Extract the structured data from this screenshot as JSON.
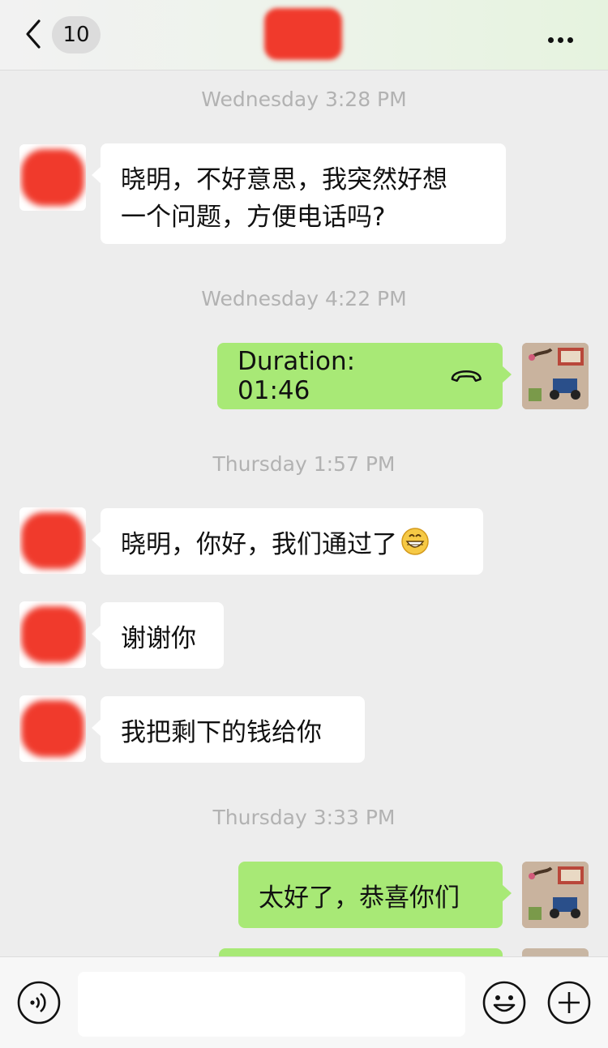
{
  "header": {
    "back_badge": "10",
    "colors": {
      "accent_green": "#a8e976",
      "redaction": "#f03a2c"
    }
  },
  "messages": [
    {
      "type": "timestamp",
      "text": "Wednesday 3:28 PM"
    },
    {
      "type": "incoming",
      "lines": [
        "晓明，不好意思，我突然好想",
        "一个问题，方便电话吗?"
      ]
    },
    {
      "type": "timestamp",
      "text": "Wednesday 4:22 PM"
    },
    {
      "type": "outgoing_call",
      "text": "Duration: 01:46",
      "icon": "phone-hangup-icon"
    },
    {
      "type": "timestamp",
      "text": "Thursday 1:57 PM"
    },
    {
      "type": "incoming",
      "text": "晓明，你好，我们通过了",
      "emoji": "grinning-face-icon"
    },
    {
      "type": "incoming",
      "text": "谢谢你"
    },
    {
      "type": "incoming",
      "text": "我把剩下的钱给你"
    },
    {
      "type": "timestamp",
      "text": "Thursday 3:33 PM"
    },
    {
      "type": "outgoing",
      "text": "太好了，恭喜你们"
    }
  ],
  "input_bar": {
    "voice_icon": "voice-icon",
    "emoji_icon": "emoji-icon",
    "plus_icon": "plus-icon",
    "input_value": ""
  }
}
